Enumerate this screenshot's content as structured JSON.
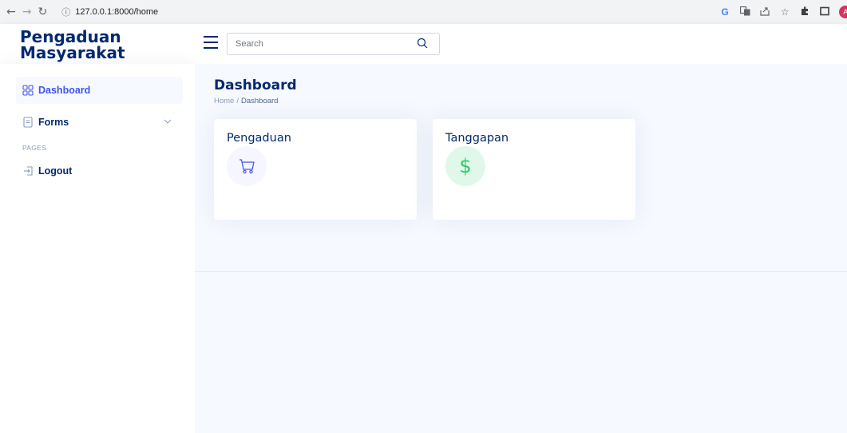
{
  "browser": {
    "url": "127.0.0.1:8000/home",
    "profile_initial": "A",
    "icons": [
      "back-icon",
      "forward-icon",
      "reload-icon",
      "site-info-icon",
      "google-icon",
      "translate-icon",
      "share-icon",
      "bookmark-star-icon",
      "extensions-icon",
      "side-panel-icon"
    ]
  },
  "header": {
    "logo_line1": "Pengaduan",
    "logo_line2": "Masyarakat",
    "search_placeholder": "Search"
  },
  "sidebar": {
    "items": [
      {
        "label": "Dashboard",
        "icon": "grid-icon",
        "active": true
      },
      {
        "label": "Forms",
        "icon": "form-icon",
        "expandable": true
      },
      {
        "label": "Logout",
        "icon": "logout-icon"
      }
    ],
    "section_heading": "PAGES"
  },
  "main": {
    "title": "Dashboard",
    "breadcrumb": [
      "Home",
      "Dashboard"
    ],
    "cards": [
      {
        "title": "Pengaduan",
        "icon": "cart-icon"
      },
      {
        "title": "Tanggapan",
        "icon": "dollar-icon",
        "symbol": "$"
      }
    ]
  },
  "colors": {
    "brand": "#012970",
    "active": "#4154f1",
    "muted": "#899bbd",
    "money": "#2eca6a",
    "avatar": "#d93064"
  }
}
